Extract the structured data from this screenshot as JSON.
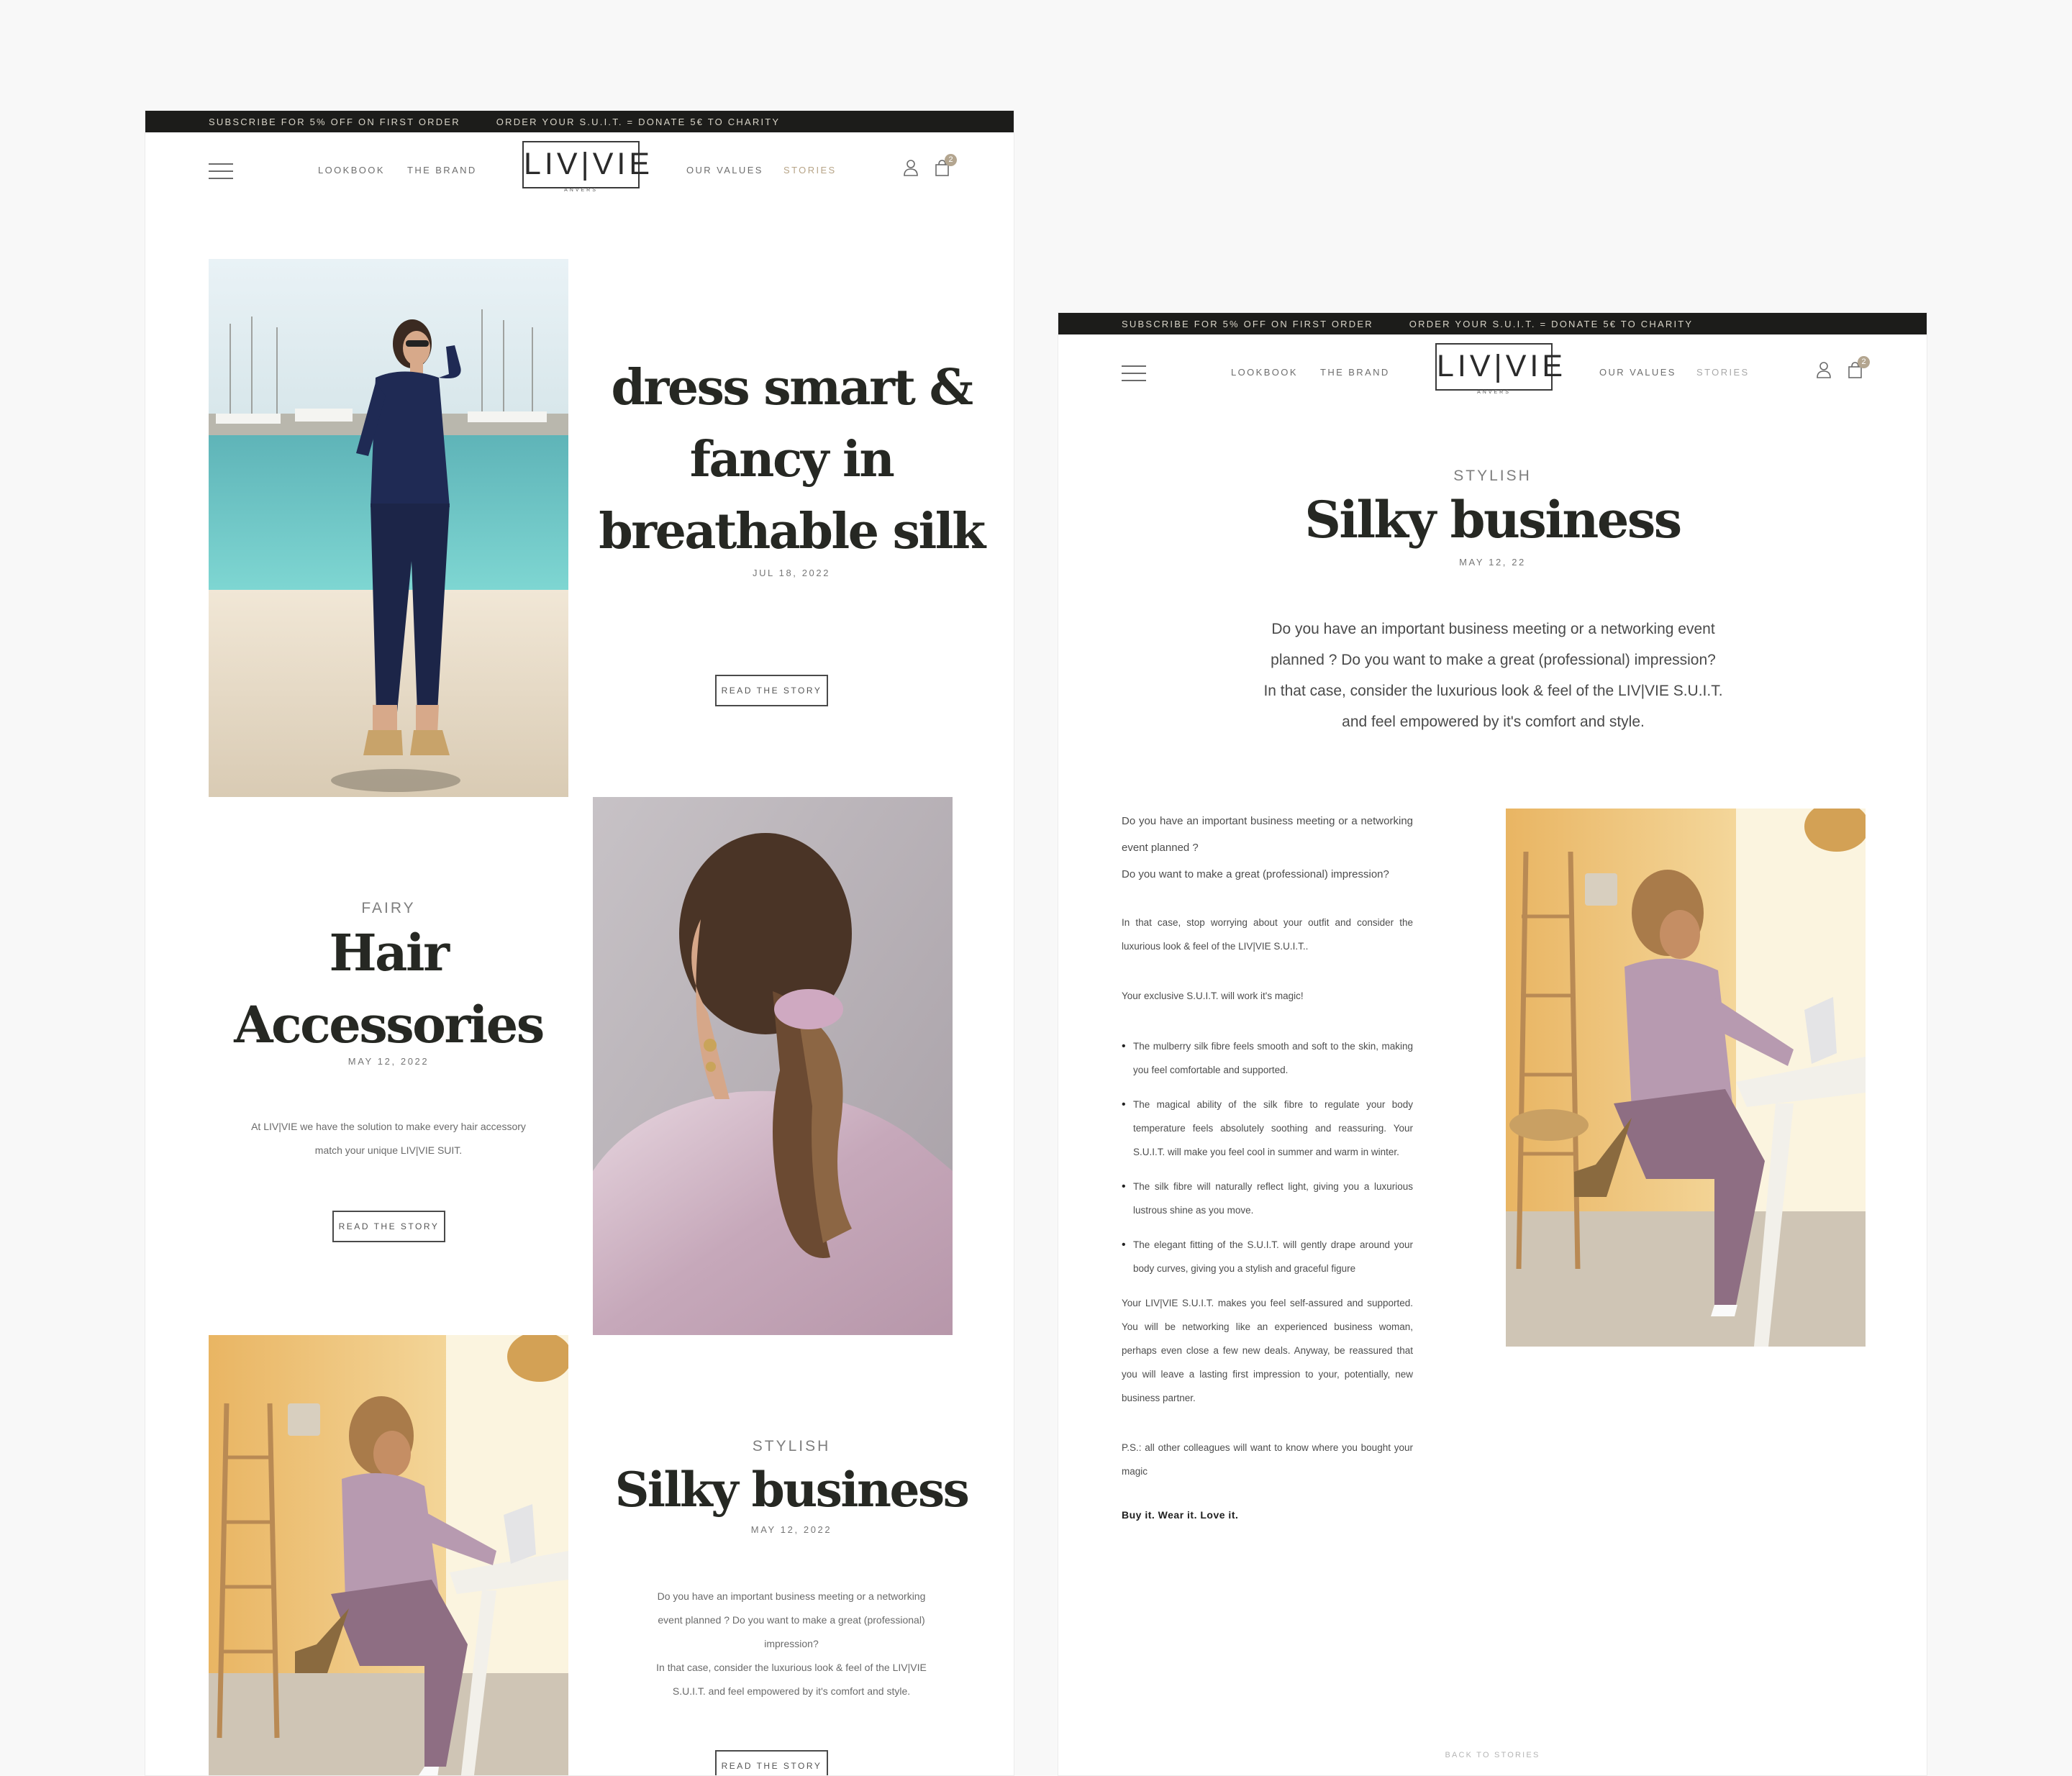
{
  "topbar": {
    "subscribe": "SUBSCRIBE FOR 5% OFF ON FIRST ORDER",
    "order": "ORDER YOUR S.U.I.T. = DONATE 5€ TO CHARITY"
  },
  "nav": {
    "lookbook": "LOOKBOOK",
    "brand": "THE BRAND",
    "values": "OUR VALUES",
    "stories": "STORIES",
    "logo_word": "LIV|VIE",
    "logo_sub": "ANVERS",
    "cart_count": "2",
    "icons": [
      "menu-icon",
      "user-icon",
      "shopping-bag-icon"
    ]
  },
  "stories": {
    "story1": {
      "title_line1": "dress smart &",
      "title_line2": "fancy in",
      "title_line3": "breathable silk",
      "date": "JUL 18, 2022",
      "button": "READ THE STORY"
    },
    "story2": {
      "eyebrow": "FAIRY",
      "title_line1": "Hair",
      "title_line2": "Accessories",
      "date": "MAY 12, 2022",
      "excerpt_line1": "At LIV|VIE we have the solution to make every hair accessory",
      "excerpt_line2": "match your unique LIV|VIE SUIT.",
      "button": "READ THE STORY"
    },
    "story3": {
      "eyebrow": "STYLISH",
      "title": "Silky business",
      "date": "MAY 12, 2022",
      "excerpt_line1": "Do you have an important business meeting or a networking",
      "excerpt_line2": "event planned ? Do you want to make a great (professional)",
      "excerpt_line3": "impression?",
      "excerpt_line4": "In that case, consider the luxurious look & feel of the LIV|VIE",
      "excerpt_line5": "S.U.I.T. and feel empowered by it's comfort and style.",
      "button": "READ THE STORY"
    }
  },
  "article": {
    "eyebrow": "STYLISH",
    "title": "Silky business",
    "date": "MAY 12, 22",
    "intro_line1": "Do you have an important business meeting or a networking event",
    "intro_line2": "planned ? Do you want to make a great (professional) impression?",
    "intro_line3": "In that case, consider the luxurious look & feel of the LIV|VIE S.U.I.T.",
    "intro_line4": "and feel empowered by it's comfort and style.",
    "p1": "Do you have an important business meeting or a networking event planned ?",
    "p2": "Do you want to make a great (professional) impression?",
    "p3": "In that case, stop worrying about your outfit and consider the luxurious look & feel of the LIV|VIE S.U.I.T..",
    "p4": "Your exclusive S.U.I.T. will work it's magic!",
    "bullets": [
      "The mulberry silk fibre feels smooth and soft to the skin, making you feel comfortable and supported.",
      "The magical ability of the silk fibre to regulate your body temperature feels absolutely soothing and reassuring. Your S.U.I.T. will make you feel cool in summer and warm in winter.",
      "The silk fibre will naturally reflect light, giving you a luxurious lustrous shine as you move.",
      "The elegant fitting of the S.U.I.T. will gently drape around your body curves, giving you a stylish and graceful figure"
    ],
    "p5": "Your LIV|VIE S.U.I.T. makes you feel self-assured and supported. You will be networking like an experienced business woman, perhaps even close a few new deals. Anyway, be reassured that you will leave a lasting first impression to your, potentially, new business partner.",
    "p6": "P.S.: all other colleagues will want to know where you bought your magic",
    "tagline": "Buy it. Wear it. Love it.",
    "back": "BACK TO STORIES"
  },
  "colors": {
    "topbar_bg": "#1c1c1a",
    "accent": "#b7a487",
    "title": "#262823",
    "background": "#f8f8f8"
  }
}
